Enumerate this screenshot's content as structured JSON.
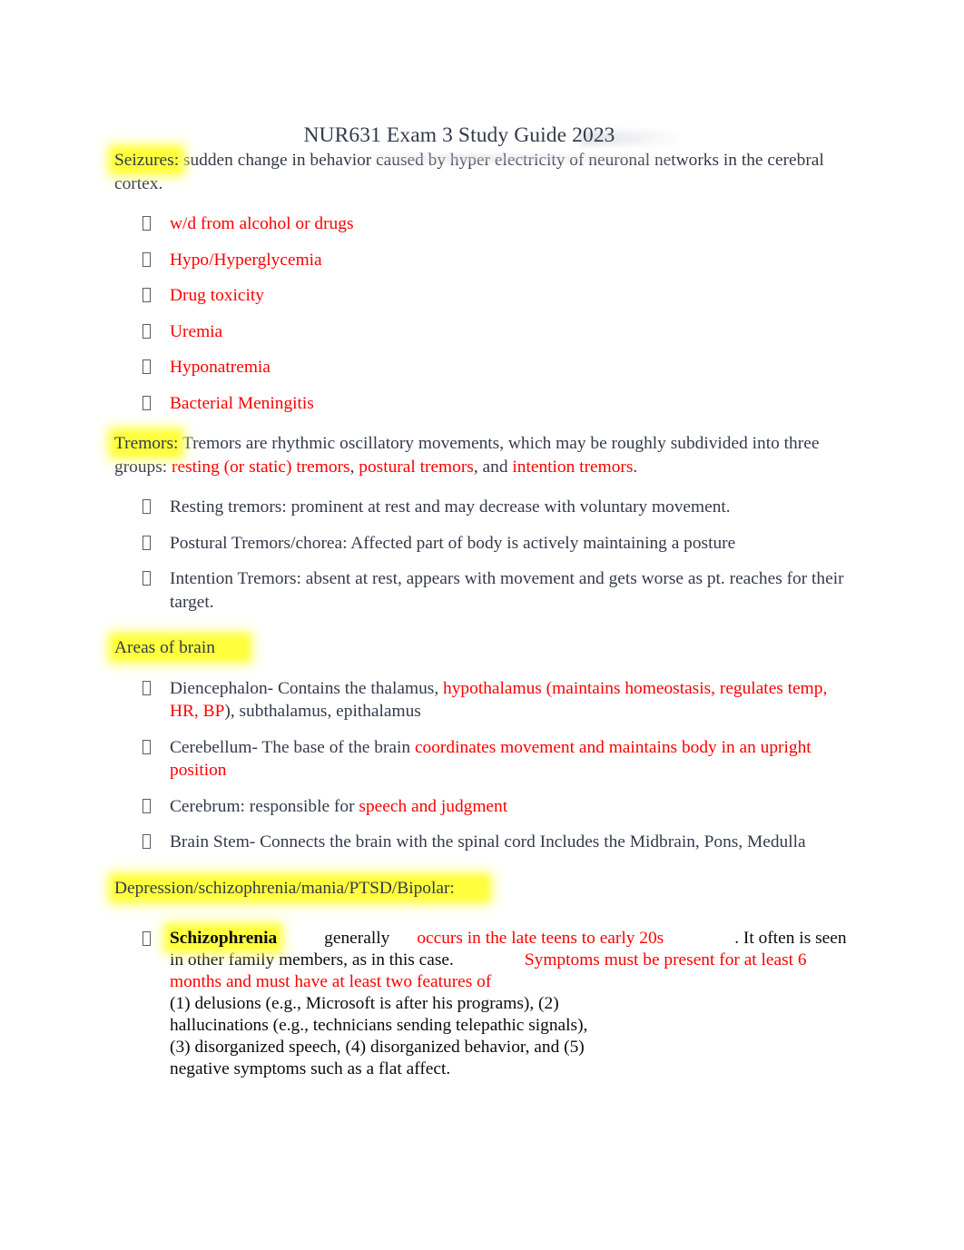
{
  "document": {
    "title": "NUR631 Exam 3 Study Guide 2023",
    "colors": {
      "body_text": "#333a4a",
      "accent_red": "#fe0000",
      "highlight_yellow": "#ffff3d",
      "plain_black": "#0b0b0b"
    }
  },
  "sections": {
    "seizures": {
      "heading": "Seizures:",
      "definition": " sudden change in behavior caused by hyper electricity of neuronal networks in the cerebral cortex.",
      "causes": [
        "w/d from alcohol or drugs",
        "Hypo/Hyperglycemia",
        "Drug toxicity",
        "Uremia",
        "Hyponatremia",
        "Bacterial Meningitis"
      ]
    },
    "tremors": {
      "heading": "Tremors:",
      "intro_part1": "  Tremors are rhythmic oscillatory movements, which may be roughly subdivided into three groups: ",
      "type1": "resting (or static) tremors",
      "sep1": ", ",
      "type2": "postural tremors",
      "sep2": ", and ",
      "type3": "intention tremors",
      "sep3": ".",
      "items": [
        {
          "label": "Resting tremors:",
          "description": "   prominent at rest and may decrease with voluntary movement."
        },
        {
          "label": "Postural Tremors/chorea:",
          "description": "    Affected part of body is actively maintaining a posture"
        },
        {
          "label": "Intention Tremors:",
          "description": "    absent at rest, appears with movement and gets worse as pt. reaches for their target."
        }
      ]
    },
    "areas_of_brain": {
      "heading": "Areas of brain",
      "items": [
        {
          "label_dark_1": "Diencephalon- Contains the thalamus, ",
          "red_1": "hypothalamus (maintains homeostasis, regulates temp, HR, BP",
          "dark_2": "), subthalamus, epithalamus"
        },
        {
          "label_dark_1": "Cerebellum-  The base of the brain ",
          "red_1": "coordinates movement and maintains body in an upright position",
          "dark_2": ""
        },
        {
          "label_dark_1": "Cerebrum:   responsible for ",
          "red_1": "speech and judgment",
          "dark_2": ""
        },
        {
          "label_dark_1": "Brain Stem-  Connects the brain with the spinal cord Includes the Midbrain, Pons, Medulla",
          "red_1": "",
          "dark_2": ""
        }
      ]
    },
    "mental_health": {
      "heading": "Depression/schizophrenia/mania/PTSD/Bipolar:",
      "schizophrenia": {
        "term": "Schizophrenia",
        "text_generally": "generally",
        "red_onset": "occurs in the late teens to early 20s",
        "text_itoften": ". It often is seen in other family members, as in this case.",
        "red_criteria": "Symptoms must be present for at least 6 months and must have at least two features of",
        "features": [
          "(1) delusions (e.g., Microsoft is after his programs), (2)",
          "hallucinations (e.g., technicians sending telepathic signals),",
          "(3) disorganized speech, (4) disorganized behavior, and (5)",
          "negative symptoms such as a flat affect."
        ]
      }
    }
  }
}
